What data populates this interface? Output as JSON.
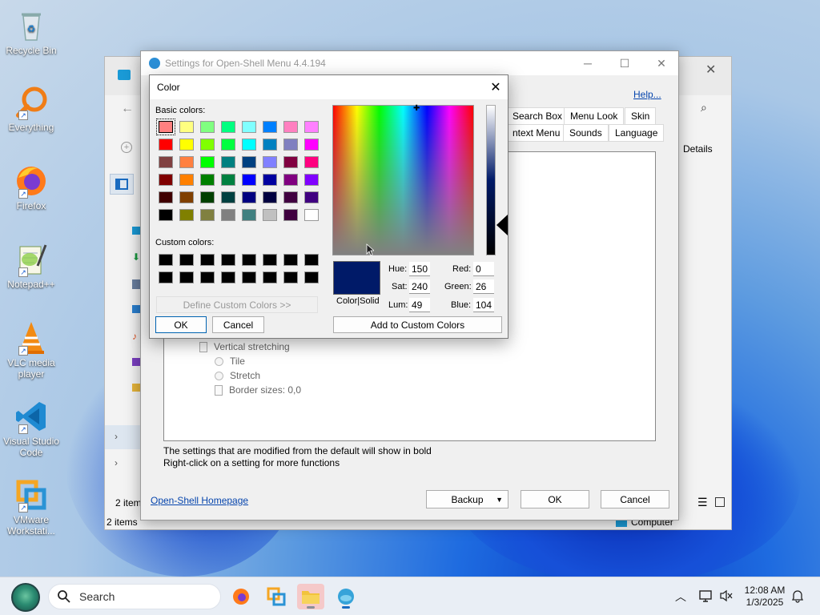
{
  "desktop": {
    "icons": [
      {
        "label": "Recycle Bin"
      },
      {
        "label": "Everything"
      },
      {
        "label": "Firefox"
      },
      {
        "label": "Notepad++"
      },
      {
        "label": "VLC media player"
      },
      {
        "label": "Visual Studio Code"
      },
      {
        "label": "VMware Workstati..."
      }
    ]
  },
  "explorer": {
    "details_label": "Details",
    "items_count_1": "2 items",
    "items_count_2": "2 items",
    "computer_label": "Computer"
  },
  "settings": {
    "title": "Settings for Open-Shell Menu 4.4.194",
    "help_link": "Help...",
    "tabs_row1": [
      "Search Box",
      "Menu Look",
      "Skin"
    ],
    "tabs_row2": [
      "ntext Menu",
      "Sounds",
      "Language"
    ],
    "tree": {
      "vertical_stretching": "Vertical stretching",
      "tile": "Tile",
      "stretch": "Stretch",
      "border_sizes": "Border sizes: 0,0"
    },
    "hint1": "The settings that are modified from the default will show in bold",
    "hint2": "Right-click on a setting for more functions",
    "homepage_link": "Open-Shell Homepage",
    "backup_label": "Backup",
    "ok_label": "OK",
    "cancel_label": "Cancel"
  },
  "color_dialog": {
    "title": "Color",
    "basic_colors_label": "Basic colors:",
    "custom_colors_label": "Custom colors:",
    "define_custom_label": "Define Custom Colors >>",
    "ok_label": "OK",
    "cancel_label": "Cancel",
    "color_solid_label": "Color|Solid",
    "hue_label": "Hue:",
    "sat_label": "Sat:",
    "lum_label": "Lum:",
    "red_label": "Red:",
    "green_label": "Green:",
    "blue_label": "Blue:",
    "hue": "150",
    "sat": "240",
    "lum": "49",
    "red": "0",
    "green": "26",
    "blue": "104",
    "add_custom_label": "Add to Custom Colors",
    "preview_color": "#001a68",
    "basic_colors": [
      [
        "#ff8080",
        "#ffff80",
        "#80ff80",
        "#00ff80",
        "#80ffff",
        "#0080ff",
        "#ff80c0",
        "#ff80ff"
      ],
      [
        "#ff0000",
        "#ffff00",
        "#80ff00",
        "#00ff40",
        "#00ffff",
        "#0080c0",
        "#8080c0",
        "#ff00ff"
      ],
      [
        "#804040",
        "#ff8040",
        "#00ff00",
        "#008080",
        "#004080",
        "#8080ff",
        "#800040",
        "#ff0080"
      ],
      [
        "#800000",
        "#ff8000",
        "#008000",
        "#008040",
        "#0000ff",
        "#0000a0",
        "#800080",
        "#8000ff"
      ],
      [
        "#400000",
        "#804000",
        "#004000",
        "#004040",
        "#000080",
        "#000040",
        "#400040",
        "#400080"
      ],
      [
        "#000000",
        "#808000",
        "#808040",
        "#808080",
        "#408080",
        "#c0c0c0",
        "#400040",
        "#ffffff"
      ]
    ],
    "custom_color": "#000000"
  },
  "taskbar": {
    "search_placeholder": "Search",
    "time": "12:08 AM",
    "date": "1/3/2025"
  }
}
